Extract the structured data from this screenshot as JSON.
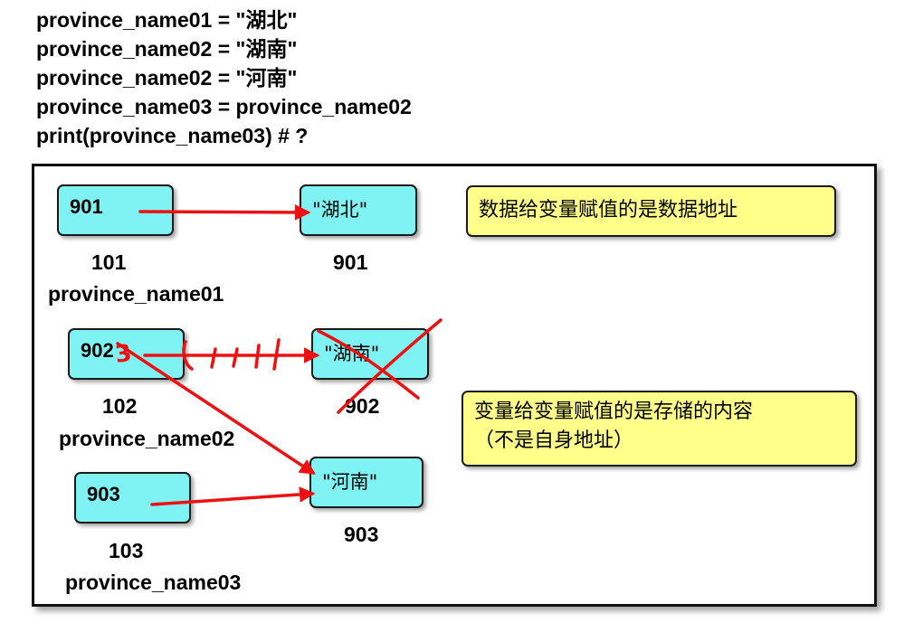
{
  "code": {
    "line1": "province_name01 = \"湖北\"",
    "line2": "province_name02 = \"湖南\"",
    "line3": "province_name02 = \"河南\"",
    "line4": "province_name03 = province_name02",
    "line5": "print(province_name03)  # ?"
  },
  "diagram": {
    "var1": {
      "box": "901",
      "addr": "101",
      "name": "province_name01"
    },
    "var2": {
      "box": "902",
      "addr": "102",
      "name": "province_name02"
    },
    "var3": {
      "box": "903",
      "addr": "103",
      "name": "province_name03"
    },
    "val1": {
      "text": "\"湖北\"",
      "addr": "901"
    },
    "val2": {
      "text": "\"湖南\"",
      "addr": "902"
    },
    "val3": {
      "text": "\"河南\"",
      "addr": "903"
    },
    "note1": "数据给变量赋值的是数据地址",
    "note2_line1": "变量给变量赋值的是存储的内容",
    "note2_line2": "（不是自身地址）",
    "annotation": "3"
  },
  "colors": {
    "box_fill": "#7ff3f3",
    "note_fill": "#ffff8a",
    "arrow": "#ee1111"
  }
}
